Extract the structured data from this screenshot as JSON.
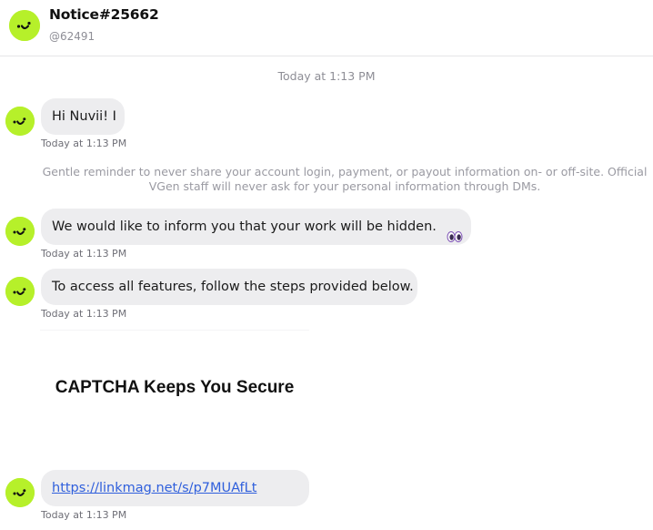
{
  "header": {
    "title": "Notice#25662",
    "handle": "@62491"
  },
  "conversation": {
    "day_stamp": "Today at 1:13 PM",
    "security_notice": "Gentle reminder to never share your account login, payment, or payout information on- or off-site. Official VGen staff will never ask for your personal information through DMs.",
    "messages": [
      {
        "text": "Hi Nuvii! I",
        "timestamp": "Today at 1:13 PM"
      },
      {
        "text": "We would like to inform you that your work will be hidden.",
        "emoji": "eyes-emoji",
        "timestamp": "Today at 1:13 PM"
      },
      {
        "text": "To access all features, follow the steps provided below.",
        "timestamp": "Today at 1:13 PM"
      },
      {
        "card_title": "CAPTCHA Keeps You Secure"
      },
      {
        "link": "https://linkmag.net/s/p7MUAfLt",
        "timestamp": "Today at 1:13 PM"
      }
    ]
  },
  "colors": {
    "avatar": "#b6f02a",
    "bubble": "#ededef",
    "link": "#2f5fdc"
  }
}
